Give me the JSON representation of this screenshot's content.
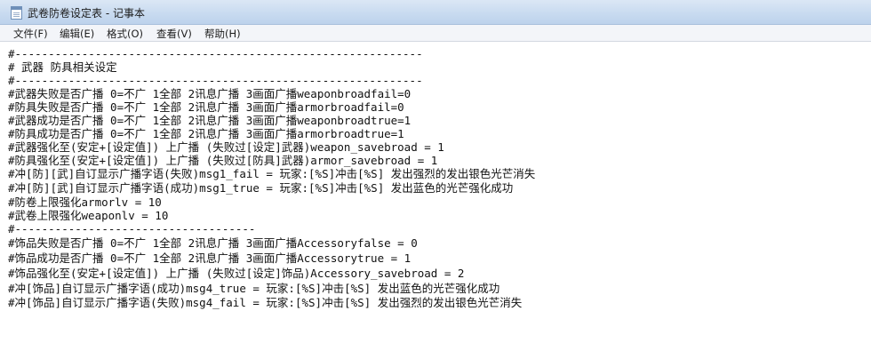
{
  "window": {
    "title": "武卷防卷设定表 - 记事本"
  },
  "menu": [
    {
      "label": "文件(F)"
    },
    {
      "label": "编辑(E)"
    },
    {
      "label": "格式(O)"
    },
    {
      "label": "查看(V)"
    },
    {
      "label": "帮助(H)"
    }
  ],
  "editor": {
    "lines": [
      "#-------------------------------------------------------------",
      "# 武器 防具相关设定",
      "#-------------------------------------------------------------",
      "#武器失败是否广播 0=不广 1全部 2讯息广播 3画面广播weaponbroadfail=0",
      "#防具失败是否广播 0=不广 1全部 2讯息广播 3画面广播armorbroadfail=0",
      "#武器成功是否广播 0=不广 1全部 2讯息广播 3画面广播weaponbroadtrue=1",
      "#防具成功是否广播 0=不广 1全部 2讯息广播 3画面广播armorbroadtrue=1",
      "#武器强化至(安定+[设定值]) 上广播 (失败过[设定]武器)weapon_savebroad = 1",
      "#防具强化至(安定+[设定值]) 上广播 (失败过[防具]武器)armor_savebroad = 1",
      "#冲[防][武]自订显示广播字语(失败)msg1_fail = 玩家:[%S]冲击[%S] 发出强烈的发出银色光芒消失",
      "#冲[防][武]自订显示广播字语(成功)msg1_true = 玩家:[%S]冲击[%S] 发出蓝色的光芒强化成功",
      "#防卷上限强化armorlv = 10",
      "#武卷上限强化weaponlv = 10",
      "#------------------------------------",
      "#饰品失败是否广播 0=不广 1全部 2讯息广播 3画面广播Accessoryfalse = 0",
      "#饰品成功是否广播 0=不广 1全部 2讯息广播 3画面广播Accessorytrue = 1",
      "#饰品强化至(安定+[设定值]) 上广播 (失败过[设定]饰品)Accessory_savebroad = 2",
      "#冲[饰品]自订显示广播字语(成功)msg4_true = 玩家:[%S]冲击[%S] 发出蓝色的光芒强化成功",
      "#冲[饰品]自订显示广播字语(失败)msg4_fail = 玩家:[%S]冲击[%S] 发出强烈的发出银色光芒消失"
    ]
  }
}
